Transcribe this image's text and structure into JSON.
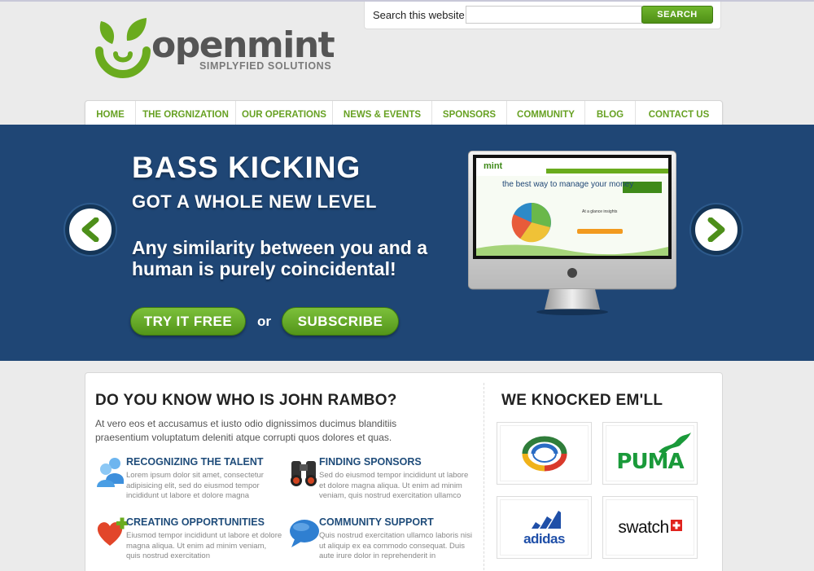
{
  "brand": {
    "name": "openmint",
    "tagline": "SIMPLYFIED SOLUTIONS",
    "color_green": "#6aab1e",
    "color_gray": "#555555"
  },
  "search": {
    "label": "Search this website",
    "value": "",
    "placeholder": "",
    "button_label": "SEARCH"
  },
  "nav": {
    "items": [
      {
        "label": "HOME"
      },
      {
        "label": "THE ORGNIZATION"
      },
      {
        "label": "OUR OPERATIONS"
      },
      {
        "label": "NEWS & EVENTS"
      },
      {
        "label": "SPONSORS"
      },
      {
        "label": "COMMUNITY"
      },
      {
        "label": "BLOG"
      },
      {
        "label": "CONTACT US"
      }
    ]
  },
  "hero": {
    "background_color": "#1f4675",
    "title": "BASS KICKING",
    "subtitle": "GOT A WHOLE NEW LEVEL",
    "tagline": "Any similarity between you and a human is purely coincidental!",
    "try_label": "TRY IT FREE",
    "or_label": "or",
    "subscribe_label": "SUBSCRIBE",
    "prev_icon": "chevron-left-icon",
    "next_icon": "chevron-right-icon"
  },
  "about": {
    "heading": "DO YOU KNOW WHO IS JOHN RAMBO?",
    "intro": "At vero eos et accusamus et iusto odio dignissimos ducimus blanditiis praesentium voluptatum deleniti atque corrupti quos dolores et quas.",
    "features": [
      {
        "icon": "people-icon",
        "title": "RECOGNIZING THE TALENT",
        "text": "Lorem ipsum dolor sit amet, consectetur adipisicing elit, sed do eiusmod tempor incididunt ut labore et dolore magna"
      },
      {
        "icon": "binoculars-icon",
        "title": "FINDING SPONSORS",
        "text": "Sed do eiusmod tempor incididunt ut labore et dolore magna aliqua. Ut enim ad minim veniam, quis nostrud exercitation ullamco"
      },
      {
        "icon": "heart-plus-icon",
        "title": "CREATING OPPORTUNITIES",
        "text": "Eiusmod tempor incididunt ut labore et dolore magna aliqua. Ut enim ad minim veniam, quis nostrud exercitation"
      },
      {
        "icon": "speech-bubble-icon",
        "title": "COMMUNITY SUPPORT",
        "text": "Quis nostrud exercitation ullamco laboris nisi ut aliquip ex ea commodo consequat. Duis aute irure dolor in reprehenderit in"
      }
    ]
  },
  "sponsors": {
    "heading": "WE KNOCKED EM'LL",
    "logos": [
      {
        "name": "ring-logo",
        "text": ""
      },
      {
        "name": "puma-logo",
        "text": "PUMA"
      },
      {
        "name": "adidas-logo",
        "text": "adidas"
      },
      {
        "name": "swatch-logo",
        "text": "swatch"
      }
    ]
  },
  "monitor": {
    "screen_brand": "mint",
    "screen_headline": "the best way to manage your money",
    "screen_caption": "At a glance insights"
  }
}
